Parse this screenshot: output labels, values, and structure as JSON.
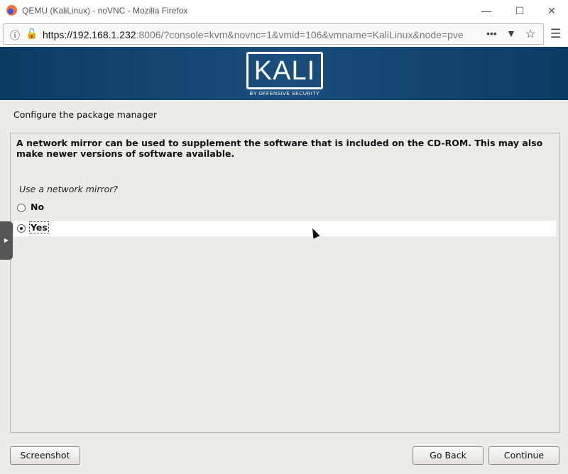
{
  "window": {
    "title": "QEMU (KaliLinux) - noVNC - Mozilla Firefox"
  },
  "browser": {
    "url_host": "https://192.168.1.232",
    "url_rest": ":8006/?console=kvm&novnc=1&vmid=106&vmname=KaliLinux&node=pve"
  },
  "banner": {
    "logo": "KALI",
    "tagline": "BY OFFENSIVE SECURITY",
    "color": "#0f3f6b"
  },
  "installer": {
    "title": "Configure the package manager",
    "description": "A network mirror can be used to supplement the software that is included on the CD-ROM. This may also make newer versions of software available.",
    "question": "Use a network mirror?",
    "options": [
      {
        "label": "No",
        "selected": false
      },
      {
        "label": "Yes",
        "selected": true
      }
    ],
    "buttons": {
      "screenshot": "Screenshot",
      "go_back": "Go Back",
      "continue": "Continue"
    }
  }
}
